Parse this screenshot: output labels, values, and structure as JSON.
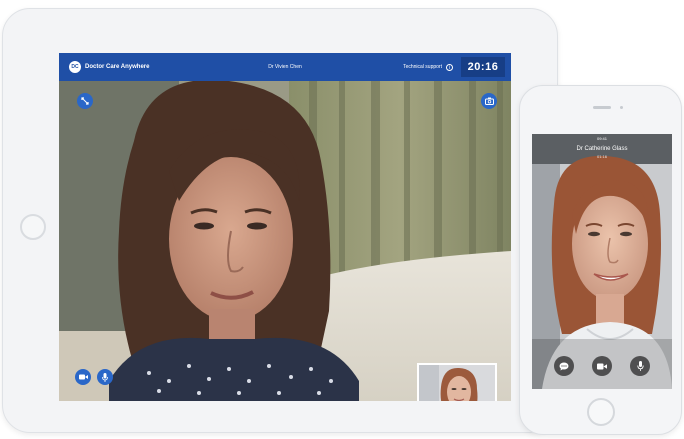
{
  "tablet_app": {
    "brand_initials": "DC",
    "brand_name": "Doctor Care Anywhere",
    "doctor_name": "Dr Vivien Chen",
    "support_label": "Technical support",
    "support_icon": "info-icon",
    "timer": "20:16",
    "icons": {
      "expand": "expand-icon",
      "camera_switch": "camera-switch-icon",
      "video": "video-camera-icon",
      "mic": "microphone-icon"
    }
  },
  "phone_app": {
    "status_time": "09:41",
    "caller_name": "Dr Catherine Glass",
    "call_duration": "01:16",
    "icons": {
      "chat": "chat-icon",
      "video": "video-camera-icon",
      "mic": "microphone-icon"
    }
  },
  "colors": {
    "brand_blue": "#1f4fa6",
    "timer_bg": "#173e86",
    "button_blue": "#2a67c8"
  }
}
